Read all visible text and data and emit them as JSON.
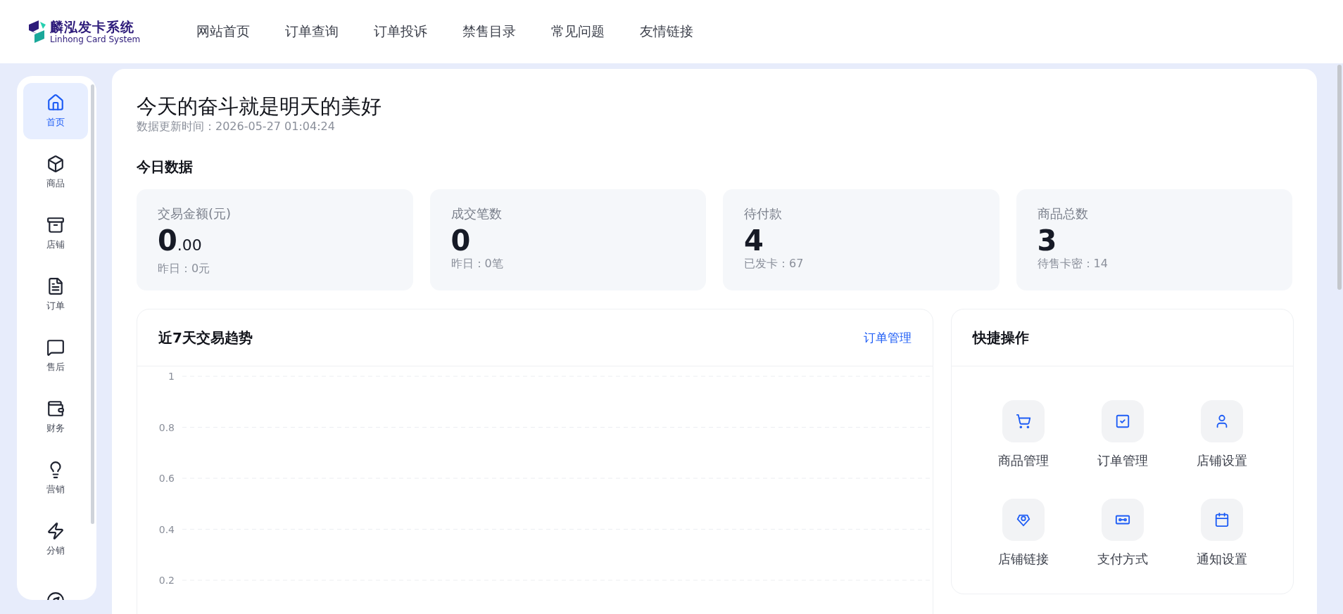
{
  "logo": {
    "name": "麟泓发卡系统",
    "subtitle": "Linhong Card System"
  },
  "nav": [
    {
      "label": "网站首页"
    },
    {
      "label": "订单查询"
    },
    {
      "label": "订单投诉"
    },
    {
      "label": "禁售目录"
    },
    {
      "label": "常见问题"
    },
    {
      "label": "友情链接"
    }
  ],
  "sidebar": {
    "items": [
      {
        "label": "首页",
        "selected": true
      },
      {
        "label": "商品",
        "selected": false
      },
      {
        "label": "店铺",
        "selected": false
      },
      {
        "label": "订单",
        "selected": false
      },
      {
        "label": "售后",
        "selected": false
      },
      {
        "label": "财务",
        "selected": false
      },
      {
        "label": "营销",
        "selected": false
      },
      {
        "label": "分销",
        "selected": false
      }
    ]
  },
  "greeting": {
    "title": "今天的奋斗就是明天的美好",
    "updated": "数据更新时间：2026-05-27 01:04:24"
  },
  "today": {
    "heading": "今日数据",
    "stats": [
      {
        "label": "交易金额(元)",
        "value": "0",
        "fraction": ".00",
        "note": "昨日：0元"
      },
      {
        "label": "成交笔数",
        "value": "0",
        "note": "昨日：0笔"
      },
      {
        "label": "待付款",
        "value": "4",
        "note": "已发卡：67"
      },
      {
        "label": "商品总数",
        "value": "3",
        "note": "待售卡密：14"
      }
    ]
  },
  "trend": {
    "title": "近7天交易趋势",
    "link": "订单管理",
    "axis_labels": [
      "1",
      "0.8",
      "0.6",
      "0.4",
      "0.2"
    ]
  },
  "quick": {
    "title": "快捷操作",
    "actions": [
      {
        "label": "商品管理"
      },
      {
        "label": "订单管理"
      },
      {
        "label": "店铺设置"
      },
      {
        "label": "店铺链接"
      },
      {
        "label": "支付方式"
      },
      {
        "label": "通知设置"
      }
    ]
  }
}
